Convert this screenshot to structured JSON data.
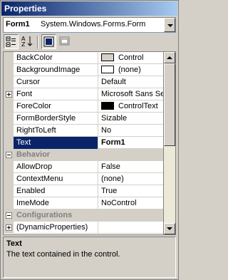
{
  "window": {
    "title": "Properties"
  },
  "object_selector": {
    "name": "Form1",
    "type": "System.Windows.Forms.Form"
  },
  "toolbar": {
    "buttons": [
      {
        "icon": "categorized-icon",
        "pressed": true
      },
      {
        "icon": "alphabetical-icon",
        "pressed": false
      },
      {
        "icon": "properties-icon",
        "pressed": true
      },
      {
        "icon": "events-icon",
        "pressed": false
      }
    ]
  },
  "grid": {
    "rows": [
      {
        "kind": "prop",
        "name": "BackColor",
        "value": "Control",
        "swatch": "#d4d0c8"
      },
      {
        "kind": "prop",
        "name": "BackgroundImage",
        "value": "(none)",
        "swatch": "#ffffff"
      },
      {
        "kind": "prop",
        "name": "Cursor",
        "value": "Default"
      },
      {
        "kind": "prop",
        "name": "Font",
        "value": "Microsoft Sans Seri",
        "expander": "plus"
      },
      {
        "kind": "prop",
        "name": "ForeColor",
        "value": "ControlText",
        "swatch": "#000000"
      },
      {
        "kind": "prop",
        "name": "FormBorderStyle",
        "value": "Sizable"
      },
      {
        "kind": "prop",
        "name": "RightToLeft",
        "value": "No"
      },
      {
        "kind": "prop",
        "name": "Text",
        "value": "Form1",
        "selected": true
      },
      {
        "kind": "category",
        "name": "Behavior",
        "expander": "minus"
      },
      {
        "kind": "prop",
        "name": "AllowDrop",
        "value": "False"
      },
      {
        "kind": "prop",
        "name": "ContextMenu",
        "value": "(none)"
      },
      {
        "kind": "prop",
        "name": "Enabled",
        "value": "True"
      },
      {
        "kind": "prop",
        "name": "ImeMode",
        "value": "NoControl"
      },
      {
        "kind": "category",
        "name": "Configurations",
        "expander": "minus"
      },
      {
        "kind": "prop",
        "name": "(DynamicProperties)",
        "value": "",
        "expander": "plus"
      }
    ]
  },
  "description": {
    "title": "Text",
    "text": "The text contained in the control."
  },
  "colors": {
    "selection": "#0a246a",
    "face": "#d4d0c8"
  }
}
